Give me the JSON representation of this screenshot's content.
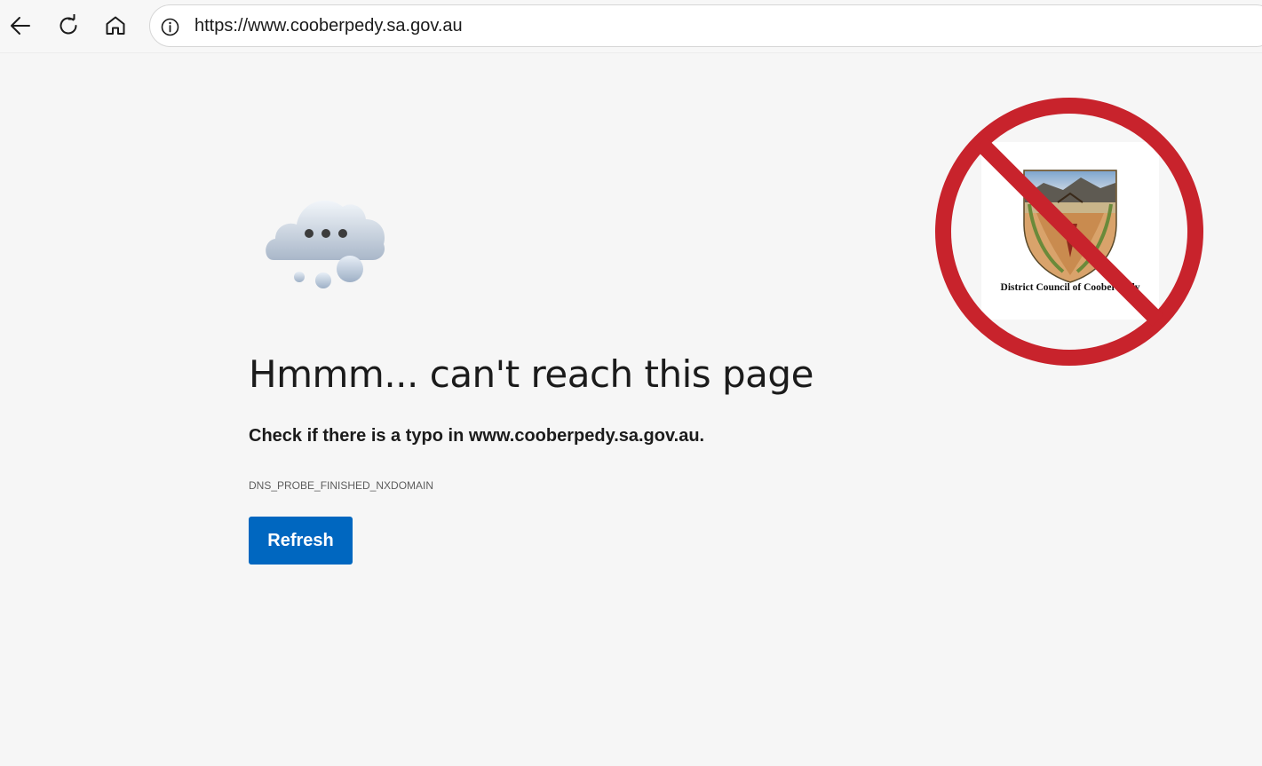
{
  "browser": {
    "url": "https://www.cooberpedy.sa.gov.au",
    "icons": [
      "back-arrow-icon",
      "reload-icon",
      "home-icon",
      "info-icon"
    ]
  },
  "error_page": {
    "headline": "Hmmm... can't reach this page",
    "message": "Check if there is a typo in www.cooberpedy.sa.gov.au.",
    "error_code": "DNS_PROBE_FINISHED_NXDOMAIN",
    "refresh_label": "Refresh",
    "accent_color": "#0067c0"
  },
  "overlay": {
    "logo_caption": "District Council of Coober Pedy",
    "sign_color": "#c8232c",
    "icon": "prohibition-sign-icon"
  }
}
